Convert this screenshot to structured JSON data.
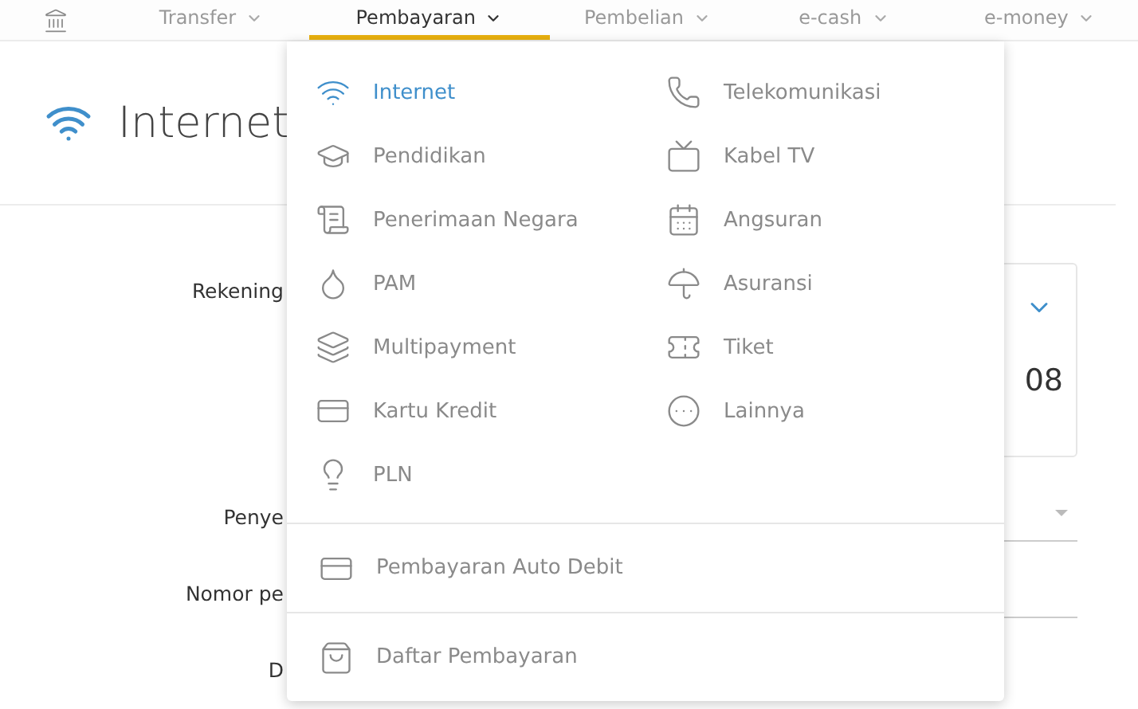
{
  "nav": {
    "tabs": [
      {
        "label": "Transfer",
        "selected": false
      },
      {
        "label": "Pembayaran",
        "selected": true
      },
      {
        "label": "Pembelian",
        "selected": false
      },
      {
        "label": "e-cash",
        "selected": false
      },
      {
        "label": "e-money",
        "selected": false
      }
    ]
  },
  "page": {
    "title": "Internet"
  },
  "form": {
    "rows": [
      {
        "kind": "account",
        "label": "Rekening",
        "value": "08"
      },
      {
        "kind": "select",
        "label": "Penye"
      },
      {
        "kind": "input",
        "label": "Nomor pe"
      },
      {
        "kind": "text",
        "label": "D"
      }
    ]
  },
  "menu": {
    "columns": [
      [
        {
          "kind": "wifi",
          "label": "Internet",
          "selected": true
        },
        {
          "kind": "education",
          "label": "Pendidikan",
          "selected": false
        },
        {
          "kind": "document",
          "label": "Penerimaan Negara",
          "selected": false
        },
        {
          "kind": "tap",
          "label": "PAM",
          "selected": false
        },
        {
          "kind": "cards",
          "label": "Multipayment",
          "selected": false
        },
        {
          "kind": "card",
          "label": "Kartu Kredit",
          "selected": false
        },
        {
          "kind": "bulb",
          "label": "PLN",
          "selected": false
        }
      ],
      [
        {
          "kind": "phone",
          "label": "Telekomunikasi",
          "selected": false
        },
        {
          "kind": "tv",
          "label": "Kabel TV",
          "selected": false
        },
        {
          "kind": "calendar",
          "label": "Angsuran",
          "selected": false
        },
        {
          "kind": "umbrella",
          "label": "Asuransi",
          "selected": false
        },
        {
          "kind": "ticket",
          "label": "Tiket",
          "selected": false
        },
        {
          "kind": "more",
          "label": "Lainnya",
          "selected": false
        }
      ]
    ],
    "extra": [
      {
        "kind": "autodebit",
        "label": "Pembayaran Auto Debit"
      },
      {
        "kind": "bag",
        "label": "Daftar Pembayaran"
      }
    ]
  }
}
